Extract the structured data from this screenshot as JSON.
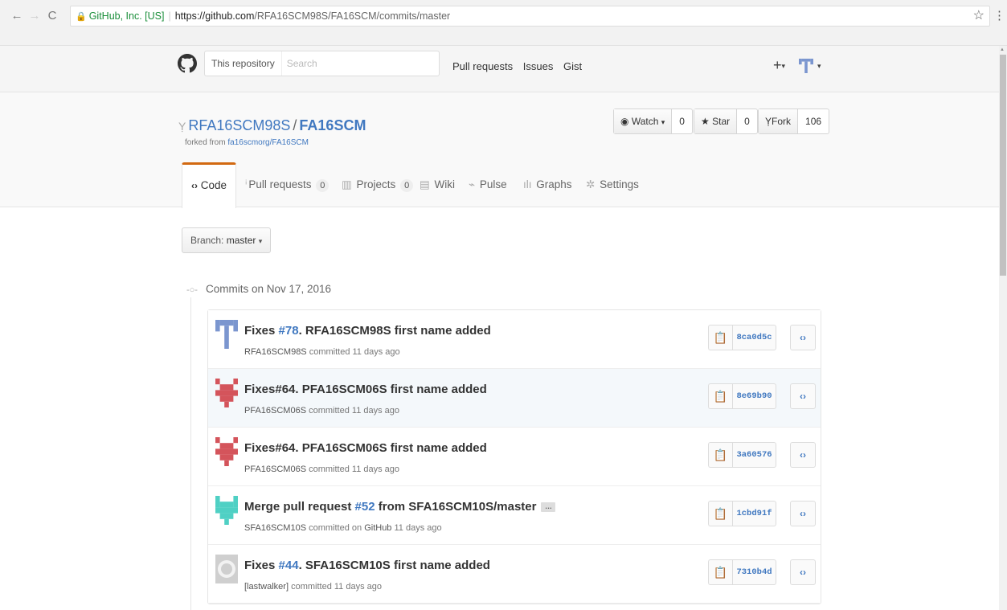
{
  "browser": {
    "back": "←",
    "forward": "→",
    "reload": "C",
    "org": "GitHub, Inc. [US]",
    "url_host": "https://github.com",
    "url_path": "/RFA16SCM98S/FA16SCM/commits/master",
    "star": "☆",
    "menu": "⋮"
  },
  "header": {
    "search_scope": "This repository",
    "search_placeholder": "Search",
    "nav": [
      "Pull requests",
      "Issues",
      "Gist"
    ],
    "plus": "+"
  },
  "repo": {
    "owner": "RFA16SCM98S",
    "name": "FA16SCM",
    "forked_prefix": "forked from",
    "forked_source": "fa16scmorg/FA16SCM",
    "watch_label": "Watch",
    "watch_count": "0",
    "star_label": "Star",
    "star_count": "0",
    "fork_label": "Fork",
    "fork_count": "106"
  },
  "tabs": [
    {
      "label": "Code",
      "icon": "<>"
    },
    {
      "label": "Pull requests",
      "count": "0"
    },
    {
      "label": "Projects",
      "count": "0"
    },
    {
      "label": "Wiki"
    },
    {
      "label": "Pulse"
    },
    {
      "label": "Graphs"
    },
    {
      "label": "Settings"
    }
  ],
  "branch": {
    "prefix": "Branch:",
    "name": "master"
  },
  "commits_date": "Commits on Nov 17, 2016",
  "commits": [
    {
      "prefix": "Fixes ",
      "link": "#78",
      "suffix": ". RFA16SCM98S first name added",
      "author": "RFA16SCM98S",
      "meta": " committed 11 days ago",
      "sha": "8ca0d5c",
      "avatar_color": "#7b96cf"
    },
    {
      "prefix": "Fixes#64. PFA16SCM06S first name added",
      "link": "",
      "suffix": "",
      "author": "PFA16SCM06S",
      "meta": " committed 11 days ago",
      "sha": "8e69b90",
      "avatar_color": "#d4545b"
    },
    {
      "prefix": "Fixes#64. PFA16SCM06S first name added",
      "link": "",
      "suffix": "",
      "author": "PFA16SCM06S",
      "meta": " committed 11 days ago",
      "sha": "3a60576",
      "avatar_color": "#d4545b"
    },
    {
      "prefix": "Merge pull request ",
      "link": "#52",
      "suffix": " from SFA16SCM10S/master",
      "author": "SFA16SCM10S",
      "meta_a": " committed on ",
      "meta_b": "GitHub",
      "meta_c": " 11 days ago",
      "sha": "1cbd91f",
      "avatar_color": "#4fd0c4"
    },
    {
      "prefix": "Fixes ",
      "link": "#44",
      "suffix": ". SFA16SCM10S first name added",
      "author": "[lastwalker]",
      "meta": " committed 11 days ago",
      "sha": "7310b4d",
      "avatar_color": "#aaaaaa"
    }
  ]
}
